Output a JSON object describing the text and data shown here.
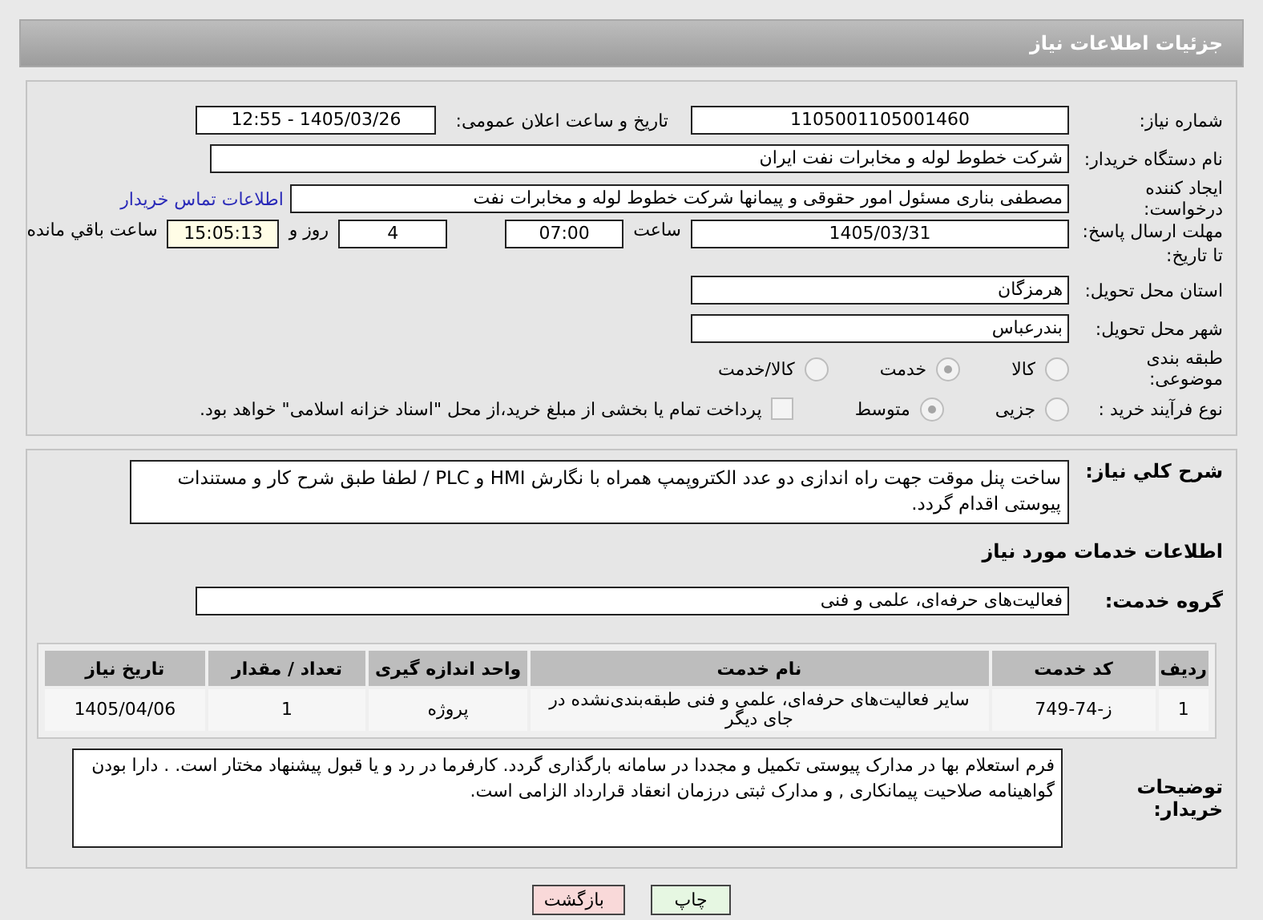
{
  "header": {
    "title": "جزئیات اطلاعات نیاز"
  },
  "need_number": {
    "label": "شماره نیاز:",
    "value": "1105001105001460"
  },
  "announce": {
    "label": "تاریخ و ساعت اعلان عمومی:",
    "value": "1405/03/26 - 12:55"
  },
  "buyer_org": {
    "label": "نام دستگاه خریدار:",
    "value": "شرکت خطوط لوله و مخابرات نفت ایران"
  },
  "requester": {
    "label": "ایجاد کننده درخواست:",
    "value": "مصطفی بناری مسئول امور حقوقی و پیمانها  شرکت خطوط لوله و مخابرات نفت",
    "link": "اطلاعات تماس خریدار"
  },
  "deadline": {
    "label": "مهلت ارسال پاسخ: تا تاریخ:",
    "date": "1405/03/31",
    "time_label": "ساعت",
    "time": "07:00",
    "days": "4",
    "days_label": "روز و",
    "remaining": "15:05:13",
    "remaining_label": "ساعت باقي مانده"
  },
  "province": {
    "label": "استان محل تحویل:",
    "value": "هرمزگان"
  },
  "city": {
    "label": "شهر محل تحویل:",
    "value": "بندرعباس"
  },
  "category": {
    "label": "طبقه بندی موضوعی:",
    "options": [
      {
        "label": "کالا",
        "selected": false
      },
      {
        "label": "خدمت",
        "selected": true
      },
      {
        "label": "کالا/خدمت",
        "selected": false
      }
    ]
  },
  "process": {
    "label": "نوع فرآیند خرید :",
    "options": [
      {
        "label": "جزیی",
        "selected": false
      },
      {
        "label": "متوسط",
        "selected": true
      }
    ],
    "payment": {
      "checked": false,
      "label": "پرداخت تمام یا بخشی از مبلغ خرید،از محل \"اسناد خزانه اسلامی\" خواهد بود."
    }
  },
  "description": {
    "label": "شرح کلي نياز:",
    "value": "ساخت پنل موقت جهت راه اندازی دو عدد الکتروپمپ همراه با نگارش HMI و PLC / لطفا طبق شرح کار و مستندات پیوستی اقدام گردد."
  },
  "services_heading": "اطلاعات خدمات مورد نیاز",
  "service_group": {
    "label": "گروه خدمت:",
    "value": "فعالیت‌های حرفه‌ای، علمی و فنی"
  },
  "table": {
    "columns": [
      "ردیف",
      "کد خدمت",
      "نام خدمت",
      "واحد اندازه گیری",
      "تعداد / مقدار",
      "تاریخ نیاز"
    ],
    "rows": [
      [
        "1",
        "ز-74-749",
        "سایر فعالیت‌های حرفه‌ای، علمی و فنی طبقه‌بندی‌نشده در جای دیگر",
        "پروژه",
        "1",
        "1405/04/06"
      ]
    ]
  },
  "buyer_notes": {
    "label": "توضیحات خریدار:",
    "value": "فرم استعلام بها در مدارک پیوستی تکمیل و مجددا در سامانه بارگذاری گردد. کارفرما در رد و یا قبول پیشنهاد مختار است. . دارا بودن گواهینامه صلاحیت پیمانکاری , و مدارک ثبتی درزمان انعقاد قرارداد الزامی است."
  },
  "buttons": [
    {
      "label": "چاپ",
      "kind": "print"
    },
    {
      "label": "بازگشت",
      "kind": "back"
    }
  ]
}
